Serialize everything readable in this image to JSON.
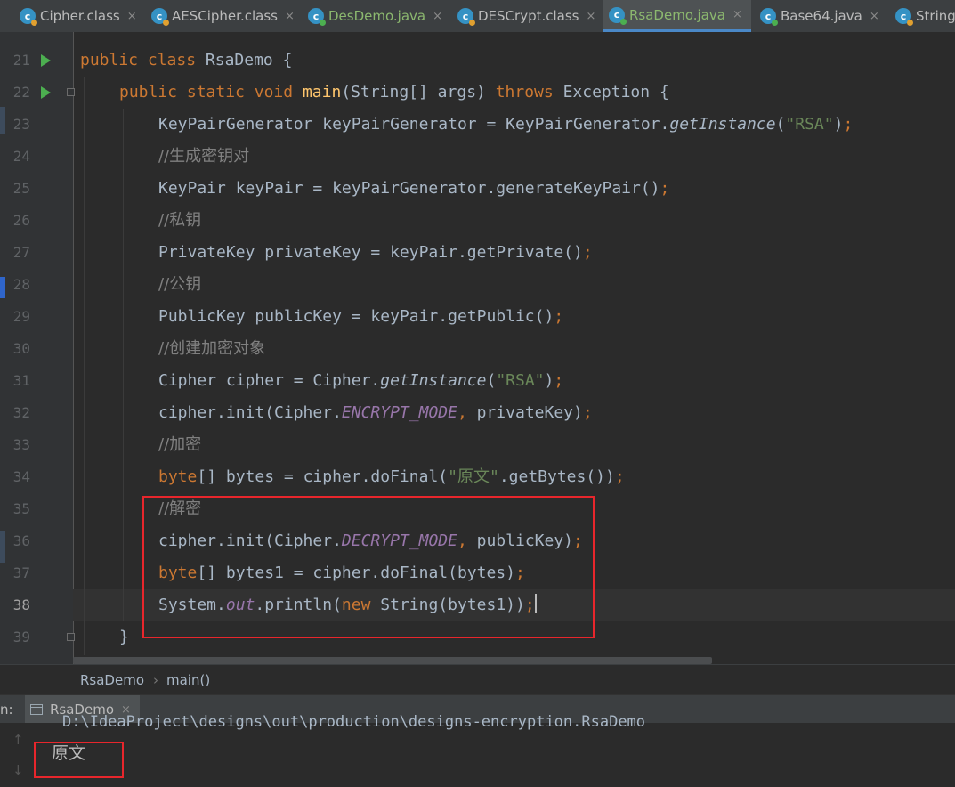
{
  "tabs": [
    {
      "label": "Cipher.class",
      "kind": "class",
      "active": false
    },
    {
      "label": "AESCipher.class",
      "kind": "class",
      "active": false
    },
    {
      "label": "DesDemo.java",
      "kind": "java",
      "active": false
    },
    {
      "label": "DESCrypt.class",
      "kind": "class",
      "active": false
    },
    {
      "label": "RsaDemo.java",
      "kind": "java",
      "active": true
    },
    {
      "label": "Base64.java",
      "kind": "java",
      "active": false
    },
    {
      "label": "String.",
      "kind": "class",
      "active": false
    }
  ],
  "tab_close_glyph": "×",
  "editor": {
    "line_numbers": [
      "21",
      "22",
      "23",
      "24",
      "25",
      "26",
      "27",
      "28",
      "29",
      "30",
      "31",
      "32",
      "33",
      "34",
      "35",
      "36",
      "37",
      "38",
      "39"
    ],
    "current_line": "38",
    "code": {
      "l21": [
        "public",
        " ",
        "class",
        " RsaDemo {"
      ],
      "l22": [
        "public",
        " ",
        "static",
        " ",
        "void",
        " ",
        "main",
        "(String[] args) ",
        "throws",
        " Exception {"
      ],
      "l23": [
        "KeyPairGenerator keyPairGenerator = KeyPairGenerator.",
        "getInstance",
        "(",
        "\"RSA\"",
        ")",
        ";"
      ],
      "l24": "//生成密钥对",
      "l25": [
        "KeyPair keyPair = keyPairGenerator.generateKeyPair()",
        ";"
      ],
      "l26": "//私钥",
      "l27": [
        "PrivateKey privateKey = keyPair.getPrivate()",
        ";"
      ],
      "l28": "//公钥",
      "l29": [
        "PublicKey publicKey = keyPair.getPublic()",
        ";"
      ],
      "l30": "//创建加密对象",
      "l31": [
        "Cipher cipher = Cipher.",
        "getInstance",
        "(",
        "\"RSA\"",
        ")",
        ";"
      ],
      "l32": [
        "cipher.init(Cipher.",
        "ENCRYPT_MODE",
        ",",
        " privateKey)",
        ";"
      ],
      "l33": "//加密",
      "l34": [
        "byte",
        "[] bytes = cipher.doFinal(",
        "\"原文\"",
        ".getBytes())",
        ";"
      ],
      "l35": "//解密",
      "l36": [
        "cipher.init(Cipher.",
        "DECRYPT_MODE",
        ",",
        " publicKey)",
        ";"
      ],
      "l37": [
        "byte",
        "[] bytes1 = cipher.doFinal(bytes)",
        ";"
      ],
      "l38": [
        "System.",
        "out",
        ".println(",
        "new",
        " String(bytes1))",
        ";"
      ],
      "l39": "}"
    }
  },
  "breadcrumb": [
    "RsaDemo",
    "main()"
  ],
  "breadcrumb_sep": "›",
  "run_panel": {
    "label": "n:",
    "tab": "RsaDemo",
    "command": "D:\\IdeaProject\\designs\\out\\production\\designs-encryption.RsaDemo",
    "output": "原文"
  },
  "colors": {
    "keyword": "#cc7832",
    "function": "#ffc66d",
    "string": "#6a8759",
    "comment": "#808080",
    "field": "#9876aa",
    "text": "#a9b7c6",
    "highlight_box": "#e8262c",
    "run_icon": "#4caf50"
  }
}
